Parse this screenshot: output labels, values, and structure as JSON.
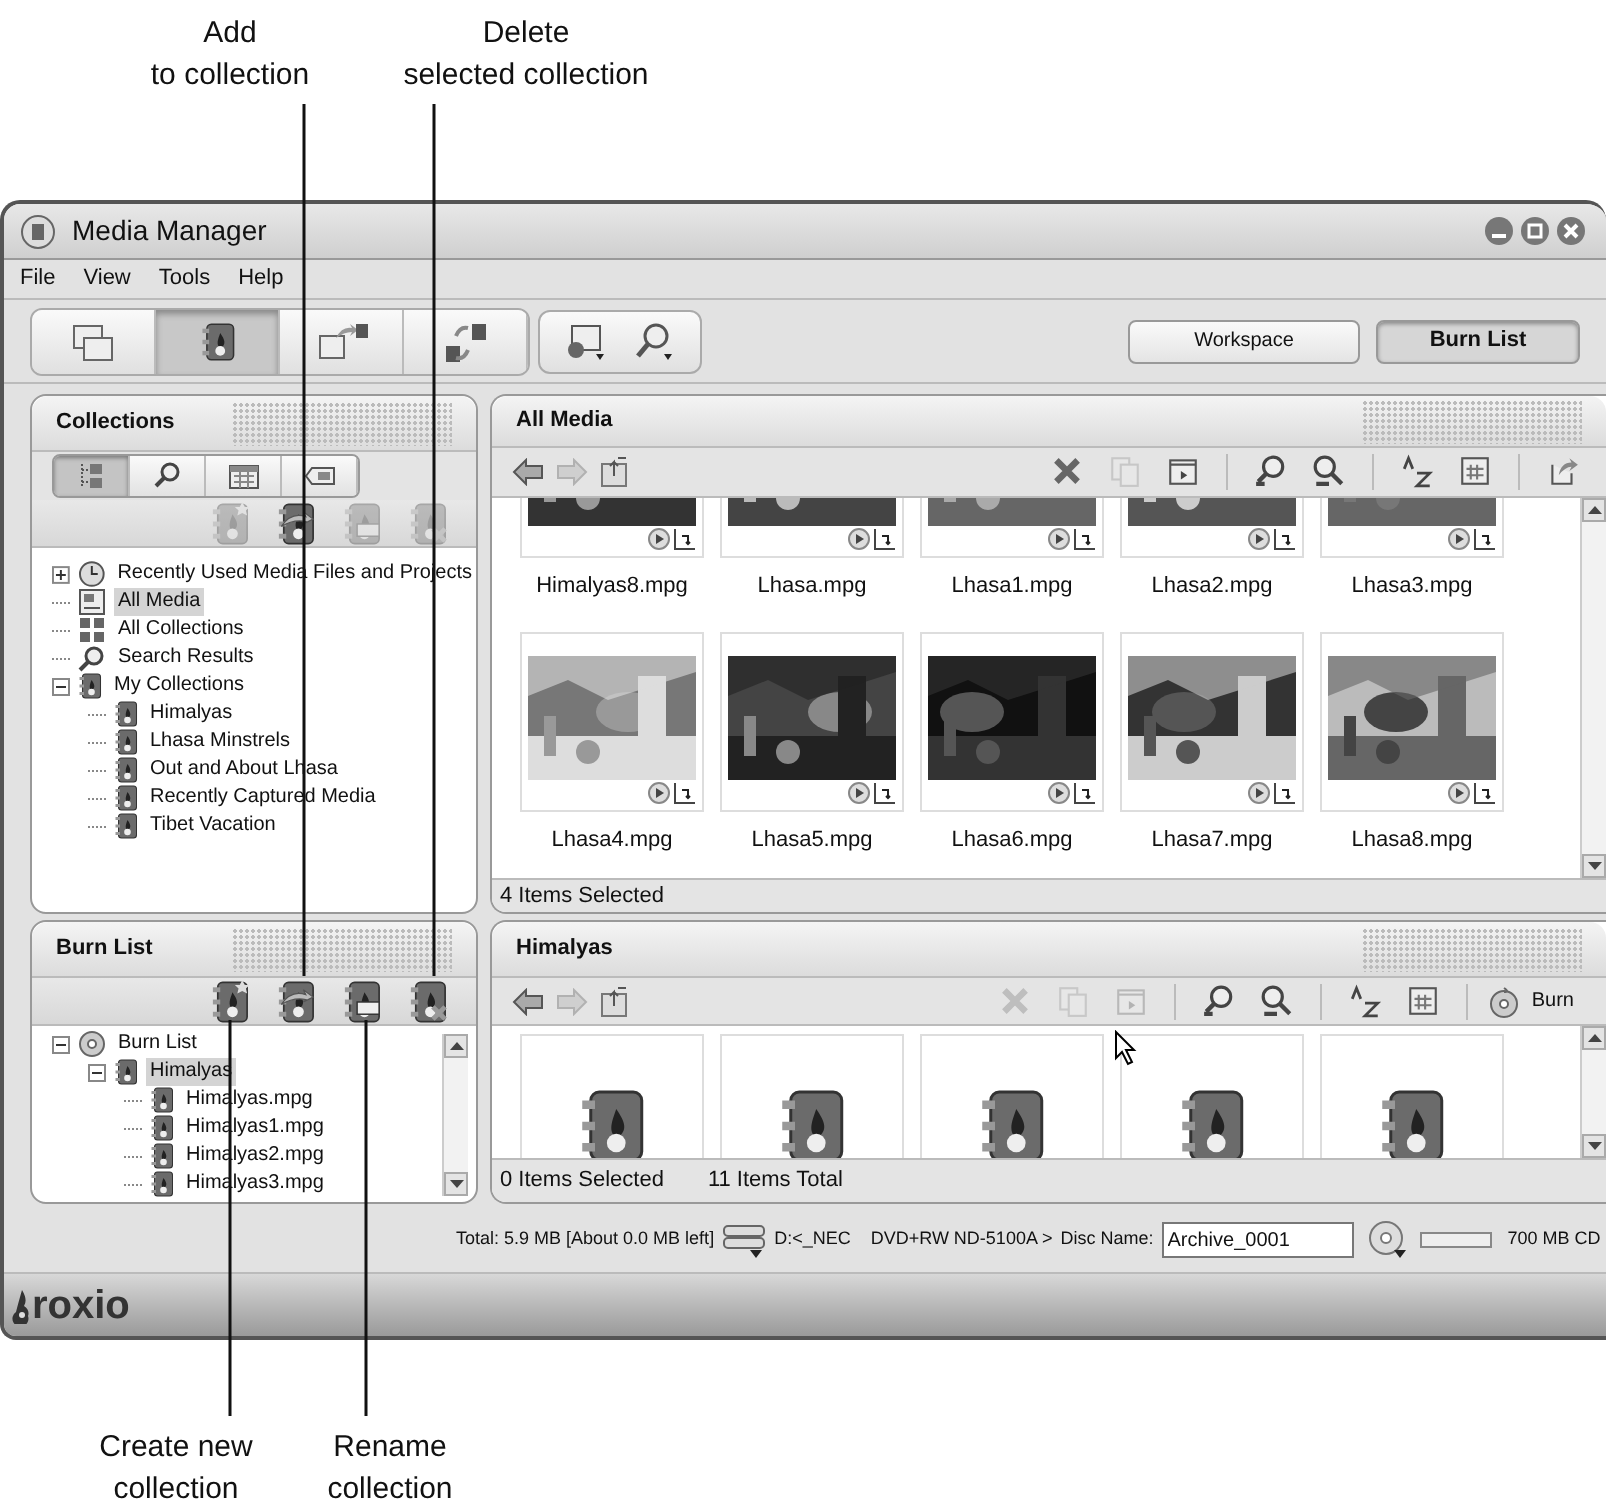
{
  "callouts_top": [
    {
      "lines": [
        "Add",
        "to collection"
      ]
    },
    {
      "lines": [
        "Delete",
        "selected collection"
      ]
    }
  ],
  "window": {
    "title": "Media Manager"
  },
  "menu": [
    "File",
    "View",
    "Tools",
    "Help"
  ],
  "toolbar": [
    {
      "kind": "folders",
      "selected": false
    },
    {
      "kind": "binder",
      "selected": true
    },
    {
      "kind": "export",
      "selected": false
    },
    {
      "kind": "swap",
      "selected": false
    }
  ],
  "mode_buttons": [
    {
      "label": "Workspace",
      "selected": false
    },
    {
      "label": "Burn List",
      "selected": true
    }
  ],
  "collections": {
    "title": "Collections",
    "tabs": [
      {
        "kind": "tree",
        "selected": true
      },
      {
        "kind": "search",
        "selected": false
      },
      {
        "kind": "calendar",
        "selected": false
      },
      {
        "kind": "tag",
        "selected": false
      }
    ],
    "actions": [
      {
        "kind": "new",
        "disabled": true
      },
      {
        "kind": "add",
        "disabled": false
      },
      {
        "kind": "rename",
        "disabled": true
      },
      {
        "kind": "delete",
        "disabled": true
      }
    ],
    "tree": [
      {
        "label": "Recently Used Media Files and Projects",
        "kind": "clock",
        "expanded": false,
        "selected": false
      },
      {
        "label": "All Media",
        "kind": "media",
        "selected": true
      },
      {
        "label": "All Collections",
        "kind": "grid",
        "selected": false
      },
      {
        "label": "Search Results",
        "kind": "search",
        "selected": false
      },
      {
        "label": "My Collections",
        "kind": "binder",
        "expanded": true,
        "selected": false,
        "children": [
          {
            "label": "Himalyas",
            "kind": "binder",
            "selected": false
          },
          {
            "label": "Lhasa Minstrels",
            "kind": "binder",
            "selected": false
          },
          {
            "label": "Out and About Lhasa",
            "kind": "binder",
            "selected": false
          },
          {
            "label": "Recently Captured Media",
            "kind": "binder",
            "selected": false
          },
          {
            "label": "Tibet Vacation",
            "kind": "binder",
            "selected": false
          }
        ]
      }
    ]
  },
  "all_media": {
    "title": "All Media",
    "tools": [
      {
        "kind": "delete",
        "disabled": false
      },
      {
        "kind": "copy",
        "disabled": true
      },
      {
        "kind": "play",
        "disabled": false
      },
      {
        "kind": "zoom-in",
        "disabled": false
      },
      {
        "kind": "zoom-out",
        "disabled": false
      },
      {
        "kind": "sort",
        "disabled": false
      },
      {
        "kind": "view",
        "disabled": false
      },
      {
        "kind": "share",
        "disabled": false
      }
    ],
    "items": [
      {
        "name": "Himalyas8.mpg"
      },
      {
        "name": "Lhasa.mpg"
      },
      {
        "name": "Lhasa1.mpg"
      },
      {
        "name": "Lhasa2.mpg"
      },
      {
        "name": "Lhasa3.mpg"
      },
      {
        "name": "Lhasa4.mpg"
      },
      {
        "name": "Lhasa5.mpg"
      },
      {
        "name": "Lhasa6.mpg"
      },
      {
        "name": "Lhasa7.mpg"
      },
      {
        "name": "Lhasa8.mpg"
      }
    ],
    "status": [
      "4 Items Selected"
    ]
  },
  "burn_list": {
    "title": "Burn List",
    "actions": [
      {
        "kind": "new",
        "disabled": false
      },
      {
        "kind": "add",
        "disabled": false
      },
      {
        "kind": "rename",
        "disabled": false
      },
      {
        "kind": "delete",
        "disabled": false
      }
    ],
    "tree": [
      {
        "label": "Burn List",
        "kind": "disc",
        "expanded": true,
        "selected": false,
        "children": [
          {
            "label": "Himalyas",
            "kind": "binder",
            "expanded": true,
            "selected": true,
            "children": [
              {
                "label": "Himalyas.mpg",
                "kind": "binder",
                "selected": false
              },
              {
                "label": "Himalyas1.mpg",
                "kind": "binder",
                "selected": false
              },
              {
                "label": "Himalyas2.mpg",
                "kind": "binder",
                "selected": false
              },
              {
                "label": "Himalyas3.mpg",
                "kind": "binder",
                "selected": false
              }
            ]
          }
        ]
      }
    ]
  },
  "himalyas": {
    "title": "Himalyas",
    "tools": [
      {
        "kind": "delete",
        "disabled": true
      },
      {
        "kind": "copy",
        "disabled": true
      },
      {
        "kind": "play",
        "disabled": true
      },
      {
        "kind": "zoom-in",
        "disabled": false
      },
      {
        "kind": "zoom-out",
        "disabled": false
      },
      {
        "kind": "sort",
        "disabled": false
      },
      {
        "kind": "view",
        "disabled": false
      }
    ],
    "burn_button": "Burn",
    "tiles": [
      {
        "kind": "collection"
      },
      {
        "kind": "collection"
      },
      {
        "kind": "collection"
      },
      {
        "kind": "collection"
      },
      {
        "kind": "collection"
      }
    ],
    "status": [
      "0 Items Selected",
      "11 Items Total"
    ]
  },
  "status_bar": {
    "total": "Total: 5.9 MB [About 0.0 MB left]",
    "drive": "D:<_NEC",
    "device": "DVD+RW ND-5100A >",
    "disc_name_label": "Disc Name:",
    "disc_name": "Archive_0001",
    "media_type": "700 MB CD"
  },
  "brand": "roxio",
  "callouts_bottom": [
    {
      "lines": [
        "Create new",
        "collection"
      ]
    },
    {
      "lines": [
        "Rename",
        "collection"
      ]
    }
  ]
}
